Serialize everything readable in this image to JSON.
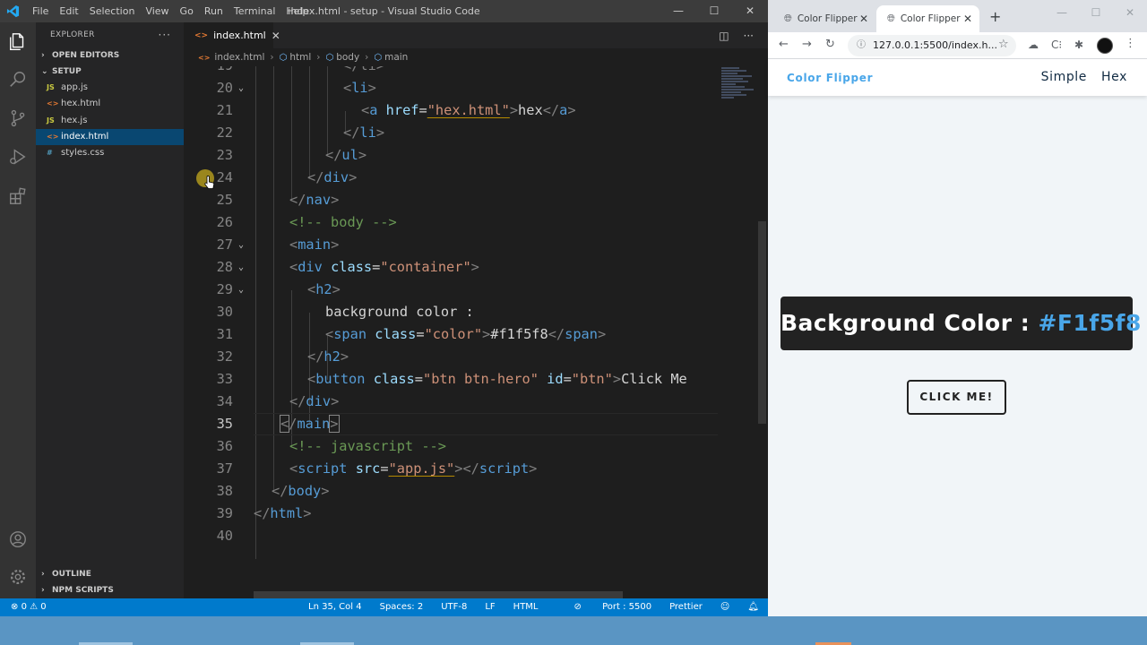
{
  "vscode": {
    "menu": [
      "File",
      "Edit",
      "Selection",
      "View",
      "Go",
      "Run",
      "Terminal",
      "Help"
    ],
    "window_title": "index.html - setup - Visual Studio Code",
    "explorer": {
      "header": "EXPLORER",
      "more": "···",
      "open_editors": "OPEN EDITORS",
      "folder": "SETUP",
      "files": [
        {
          "name": "app.js",
          "type": "js"
        },
        {
          "name": "hex.html",
          "type": "html"
        },
        {
          "name": "hex.js",
          "type": "js"
        },
        {
          "name": "index.html",
          "type": "html",
          "active": true
        },
        {
          "name": "styles.css",
          "type": "css"
        }
      ],
      "outline": "OUTLINE",
      "npm_scripts": "NPM SCRIPTS"
    },
    "tab": {
      "label": "index.html"
    },
    "breadcrumb": [
      "index.html",
      "html",
      "body",
      "main"
    ],
    "code_lines": [
      {
        "n": "19"
      },
      {
        "n": "20"
      },
      {
        "n": "21"
      },
      {
        "n": "22"
      },
      {
        "n": "23"
      },
      {
        "n": "24"
      },
      {
        "n": "25"
      },
      {
        "n": "26"
      },
      {
        "n": "27"
      },
      {
        "n": "28"
      },
      {
        "n": "29"
      },
      {
        "n": "30"
      },
      {
        "n": "31"
      },
      {
        "n": "32"
      },
      {
        "n": "33"
      },
      {
        "n": "34"
      },
      {
        "n": "35"
      },
      {
        "n": "36"
      },
      {
        "n": "37"
      },
      {
        "n": "38"
      },
      {
        "n": "39"
      },
      {
        "n": "40"
      }
    ],
    "code_text": {
      "l19": "</li>",
      "l20a": "<",
      "l20b": "li",
      "l20c": ">",
      "l21_tag": "a",
      "l21_attr": "href",
      "l21_val": "\"hex.html\"",
      "l21_text": "hex",
      "l21_close": "a",
      "l22": "li",
      "l23": "ul",
      "l24": "div",
      "l25": "nav",
      "l26": "<!-- body -->",
      "l27": "main",
      "l28_tag": "div",
      "l28_attr": "class",
      "l28_val": "\"container\"",
      "l29": "h2",
      "l30": "background color :",
      "l31_tag": "span",
      "l31_attr": "class",
      "l31_val": "\"color\"",
      "l31_text": "#f1f5f8",
      "l31_close": "span",
      "l32": "h2",
      "l33_tag": "button",
      "l33_attr1": "class",
      "l33_val1": "\"btn btn-hero\"",
      "l33_attr2": "id",
      "l33_val2": "\"btn\"",
      "l33_text": "Click Me",
      "l34": "div",
      "l35": "main",
      "l36": "<!-- javascript -->",
      "l37_tag": "script",
      "l37_attr": "src",
      "l37_val": "\"app.js\"",
      "l37_close": "script",
      "l38": "body",
      "l39": "html"
    },
    "status": {
      "errors": "0",
      "warnings": "0",
      "position": "Ln 35, Col 4",
      "spaces": "Spaces: 2",
      "encoding": "UTF-8",
      "eol": "LF",
      "language": "HTML",
      "port": "Port : 5500",
      "formatter": "Prettier"
    }
  },
  "browser": {
    "tabs": [
      {
        "title": "Color Flipper"
      },
      {
        "title": "Color Flipper"
      }
    ],
    "url": "127.0.0.1:5500/index.h...",
    "page": {
      "brand": "Color Flipper",
      "nav": [
        "Simple",
        "Hex"
      ],
      "hero_label": "Background Color : ",
      "hero_color": "#F1f5f8",
      "button": "CLICK ME!"
    }
  },
  "colors": {
    "vscode_accent": "#007acc",
    "brand_blue": "#49a6e9",
    "page_bg": "#f1f5f8",
    "hero_bg": "#222222"
  }
}
